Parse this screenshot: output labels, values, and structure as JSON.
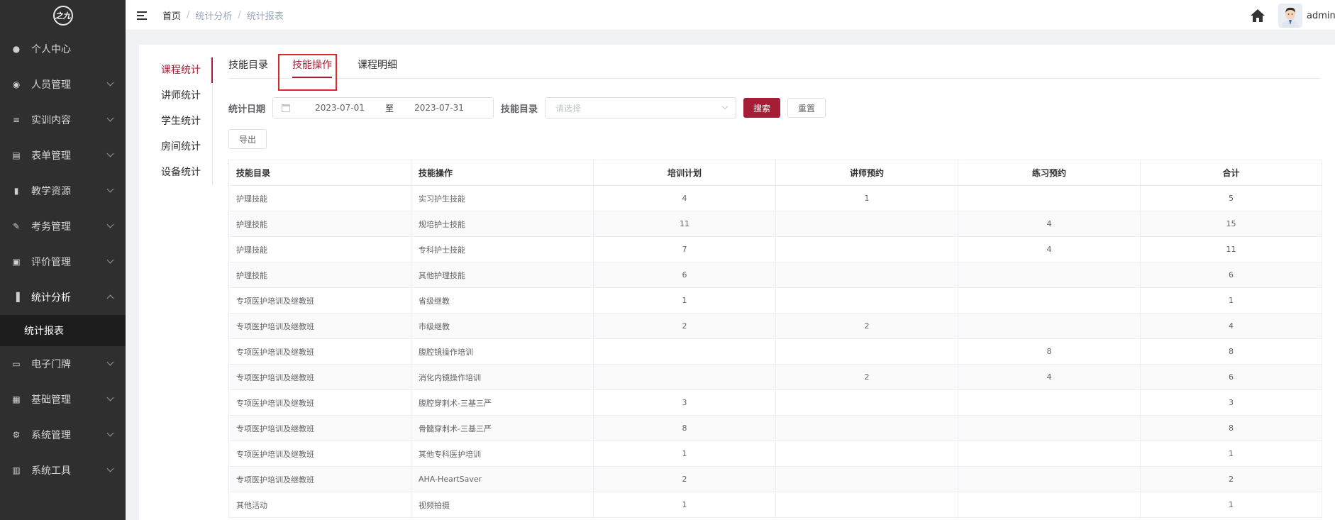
{
  "logo": {
    "text": "之九"
  },
  "sidebar": {
    "items": [
      {
        "label": "个人中心",
        "icon": "user-icon",
        "has_children": false
      },
      {
        "label": "人员管理",
        "icon": "users-icon",
        "has_children": true
      },
      {
        "label": "实训内容",
        "icon": "document-icon",
        "has_children": true
      },
      {
        "label": "表单管理",
        "icon": "form-icon",
        "has_children": true
      },
      {
        "label": "教学资源",
        "icon": "book-icon",
        "has_children": true
      },
      {
        "label": "考务管理",
        "icon": "edit-icon",
        "has_children": true
      },
      {
        "label": "评价管理",
        "icon": "rating-icon",
        "has_children": true
      },
      {
        "label": "统计分析",
        "icon": "bar-chart-icon",
        "has_children": true,
        "expanded": true
      },
      {
        "label": "电子门牌",
        "icon": "monitor-icon",
        "has_children": true
      },
      {
        "label": "基础管理",
        "icon": "grid-icon",
        "has_children": true
      },
      {
        "label": "系统管理",
        "icon": "gear-icon",
        "has_children": true
      },
      {
        "label": "系统工具",
        "icon": "toolbox-icon",
        "has_children": true
      }
    ],
    "sub_items": [
      {
        "label": "统计报表",
        "active": true
      }
    ]
  },
  "header": {
    "breadcrumb": [
      "首页",
      "统计分析",
      "统计报表"
    ],
    "username": "admin"
  },
  "vertical_tabs": [
    {
      "label": "课程统计",
      "active": true
    },
    {
      "label": "讲师统计",
      "active": false
    },
    {
      "label": "学生统计",
      "active": false
    },
    {
      "label": "房间统计",
      "active": false
    },
    {
      "label": "设备统计",
      "active": false
    }
  ],
  "horizontal_tabs": [
    {
      "label": "技能目录",
      "active": false
    },
    {
      "label": "技能操作",
      "active": true
    },
    {
      "label": "课程明细",
      "active": false
    }
  ],
  "filters": {
    "date_label": "统计日期",
    "start_date": "2023-07-01",
    "range_separator": "至",
    "end_date": "2023-07-31",
    "catalog_label": "技能目录",
    "catalog_placeholder": "请选择",
    "search_label": "搜索",
    "reset_label": "重置"
  },
  "export_label": "导出",
  "table": {
    "columns": [
      "技能目录",
      "技能操作",
      "培训计划",
      "讲师预约",
      "练习预约",
      "合计"
    ],
    "rows": [
      [
        "护理技能",
        "实习护生技能",
        "4",
        "1",
        "",
        "5"
      ],
      [
        "护理技能",
        "规培护士技能",
        "11",
        "",
        "4",
        "15"
      ],
      [
        "护理技能",
        "专科护士技能",
        "7",
        "",
        "4",
        "11"
      ],
      [
        "护理技能",
        "其他护理技能",
        "6",
        "",
        "",
        "6"
      ],
      [
        "专项医护培训及继教班",
        "省级继教",
        "1",
        "",
        "",
        "1"
      ],
      [
        "专项医护培训及继教班",
        "市级继教",
        "2",
        "2",
        "",
        "4"
      ],
      [
        "专项医护培训及继教班",
        "腹腔镜操作培训",
        "",
        "",
        "8",
        "8"
      ],
      [
        "专项医护培训及继教班",
        "消化内镜操作培训",
        "",
        "2",
        "4",
        "6"
      ],
      [
        "专项医护培训及继教班",
        "腹腔穿刺术-三基三严",
        "3",
        "",
        "",
        "3"
      ],
      [
        "专项医护培训及继教班",
        "骨髓穿刺术-三基三严",
        "8",
        "",
        "",
        "8"
      ],
      [
        "专项医护培训及继教班",
        "其他专科医护培训",
        "1",
        "",
        "",
        "1"
      ],
      [
        "专项医护培训及继教班",
        "AHA-HeartSaver",
        "2",
        "",
        "",
        "2"
      ],
      [
        "其他活动",
        "视频拍摄",
        "1",
        "",
        "",
        "1"
      ]
    ]
  },
  "colors": {
    "accent": "#a61d36",
    "sidebar_bg": "#2f2f2f",
    "highlight": "#e0262b"
  }
}
